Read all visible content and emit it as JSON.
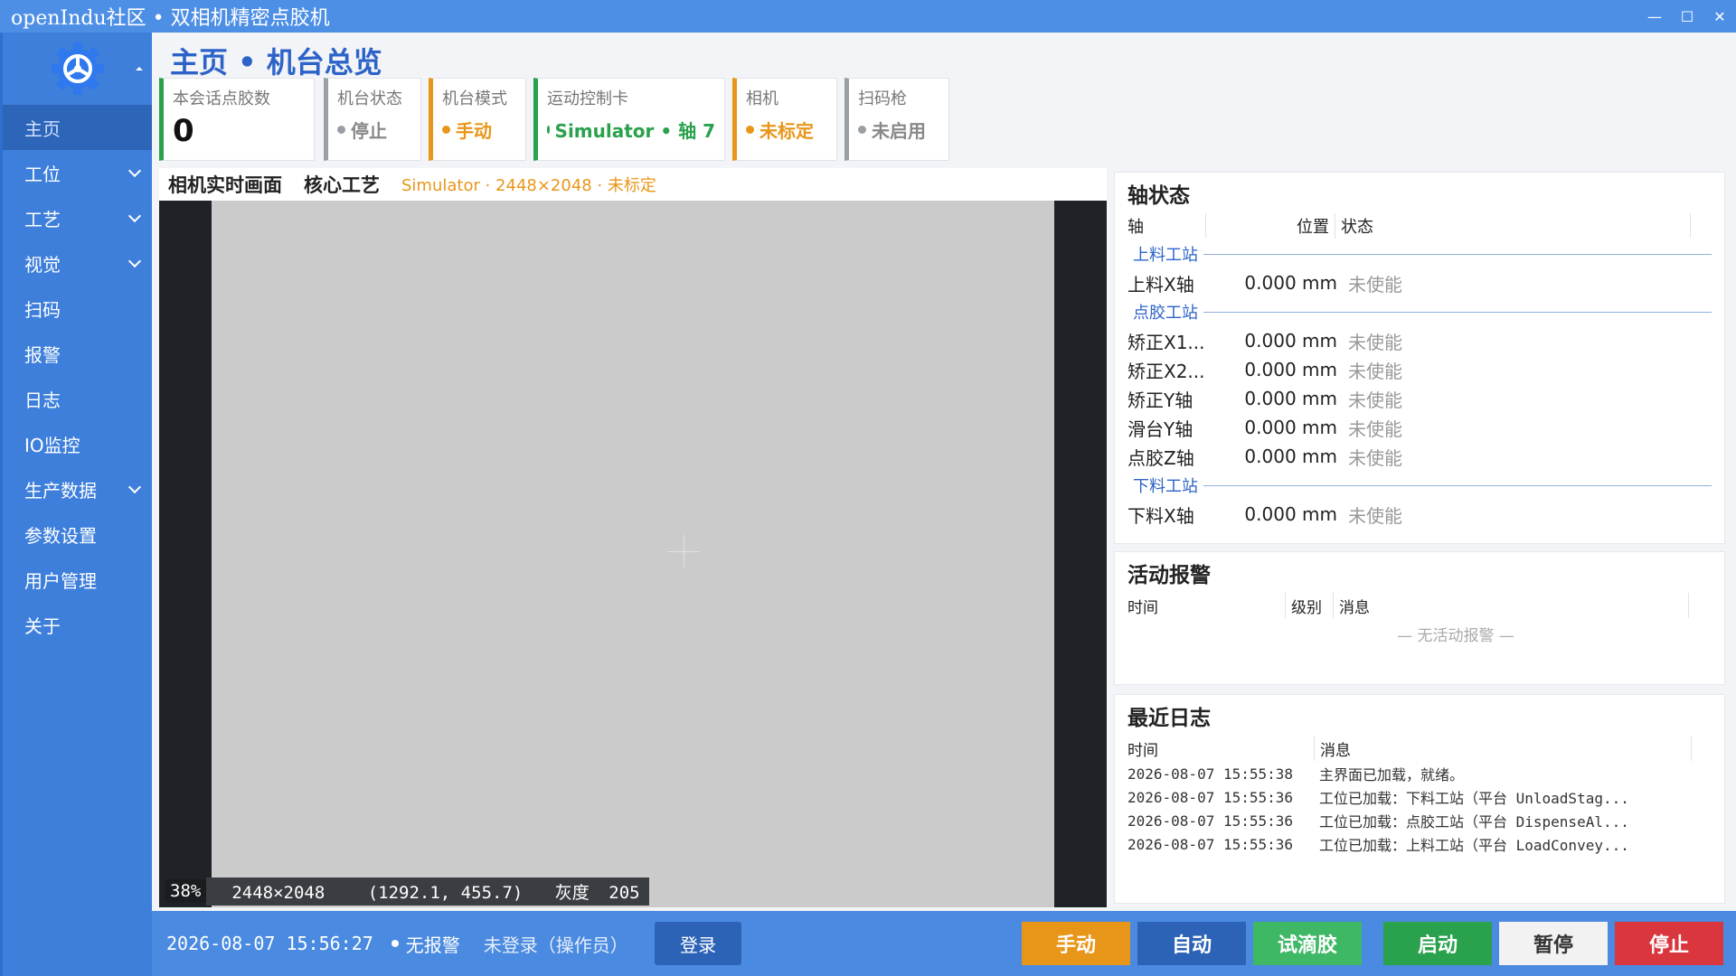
{
  "window": {
    "title": "openIndu社区  •  双相机精密点胶机",
    "min_glyph": "—",
    "max_glyph": "☐",
    "close_glyph": "✕"
  },
  "sidebar": {
    "items": [
      {
        "label": "主页",
        "active": true,
        "expandable": false
      },
      {
        "label": "工位",
        "active": false,
        "expandable": true
      },
      {
        "label": "工艺",
        "active": false,
        "expandable": true
      },
      {
        "label": "视觉",
        "active": false,
        "expandable": true
      },
      {
        "label": "扫码",
        "active": false,
        "expandable": false
      },
      {
        "label": "报警",
        "active": false,
        "expandable": false
      },
      {
        "label": "日志",
        "active": false,
        "expandable": false
      },
      {
        "label": "IO监控",
        "active": false,
        "expandable": false
      },
      {
        "label": "生产数据",
        "active": false,
        "expandable": true
      },
      {
        "label": "参数设置",
        "active": false,
        "expandable": false
      },
      {
        "label": "用户管理",
        "active": false,
        "expandable": false
      },
      {
        "label": "关于",
        "active": false,
        "expandable": false
      }
    ]
  },
  "header": {
    "title": "主页 • 机台总览"
  },
  "cards": {
    "dispense_count": {
      "label": "本会话点胶数",
      "value": "0"
    },
    "machine_state": {
      "label": "机台状态",
      "value": "停止"
    },
    "machine_mode": {
      "label": "机台模式",
      "value": "手动"
    },
    "motion_card": {
      "label": "运动控制卡",
      "value": "Simulator • 轴 7"
    },
    "camera": {
      "label": "相机",
      "value": "未标定"
    },
    "scanner": {
      "label": "扫码枪",
      "value": "未启用"
    }
  },
  "camera_panel": {
    "tab_live": "相机实时画面",
    "tab_process": "核心工艺",
    "info": "Simulator · 2448×2048 · 未标定",
    "zoom": "38%",
    "resolution": "2448×2048",
    "cursor": "(1292.1, 455.7)",
    "gray_label": "灰度",
    "gray_value": "205"
  },
  "axis_panel": {
    "title": "轴状态",
    "col_axis": "轴",
    "col_position": "位置",
    "col_state": "状态",
    "groups": [
      {
        "name": "上料工站",
        "axes": [
          {
            "name": "上料X轴",
            "position": "0.000 mm",
            "state": "未使能"
          }
        ]
      },
      {
        "name": "点胶工站",
        "axes": [
          {
            "name": "矫正X1...",
            "position": "0.000 mm",
            "state": "未使能"
          },
          {
            "name": "矫正X2...",
            "position": "0.000 mm",
            "state": "未使能"
          },
          {
            "name": "矫正Y轴",
            "position": "0.000 mm",
            "state": "未使能"
          },
          {
            "name": "滑台Y轴",
            "position": "0.000 mm",
            "state": "未使能"
          },
          {
            "name": "点胶Z轴",
            "position": "0.000 mm",
            "state": "未使能"
          }
        ]
      },
      {
        "name": "下料工站",
        "axes": [
          {
            "name": "下料X轴",
            "position": "0.000 mm",
            "state": "未使能"
          }
        ]
      }
    ]
  },
  "alarm_panel": {
    "title": "活动报警",
    "col_time": "时间",
    "col_level": "级别",
    "col_message": "消息",
    "empty": "— 无活动报警 —"
  },
  "log_panel": {
    "title": "最近日志",
    "col_time": "时间",
    "col_message": "消息",
    "rows": [
      {
        "time": "2026-08-07 15:55:38",
        "message": "主界面已加载，就绪。"
      },
      {
        "time": "2026-08-07 15:55:36",
        "message": "工位已加载：下料工站（平台 UnloadStag..."
      },
      {
        "time": "2026-08-07 15:55:36",
        "message": "工位已加载：点胶工站（平台 DispenseAl..."
      },
      {
        "time": "2026-08-07 15:55:36",
        "message": "工位已加载：上料工站（平台 LoadConvey..."
      }
    ]
  },
  "statusbar": {
    "clock": "2026-08-07 15:56:27",
    "alarm": "无报警",
    "user": "未登录（操作员）",
    "login": "登录",
    "buttons": {
      "manual": "手动",
      "auto": "自动",
      "trial": "试滴胶",
      "start": "启动",
      "pause": "暂停",
      "stop": "停止"
    }
  },
  "colors": {
    "primary": "#3d7fdb",
    "green": "#2aa14d",
    "orange": "#e8961a",
    "gray": "#9a9ea5",
    "danger": "#d9363e"
  }
}
